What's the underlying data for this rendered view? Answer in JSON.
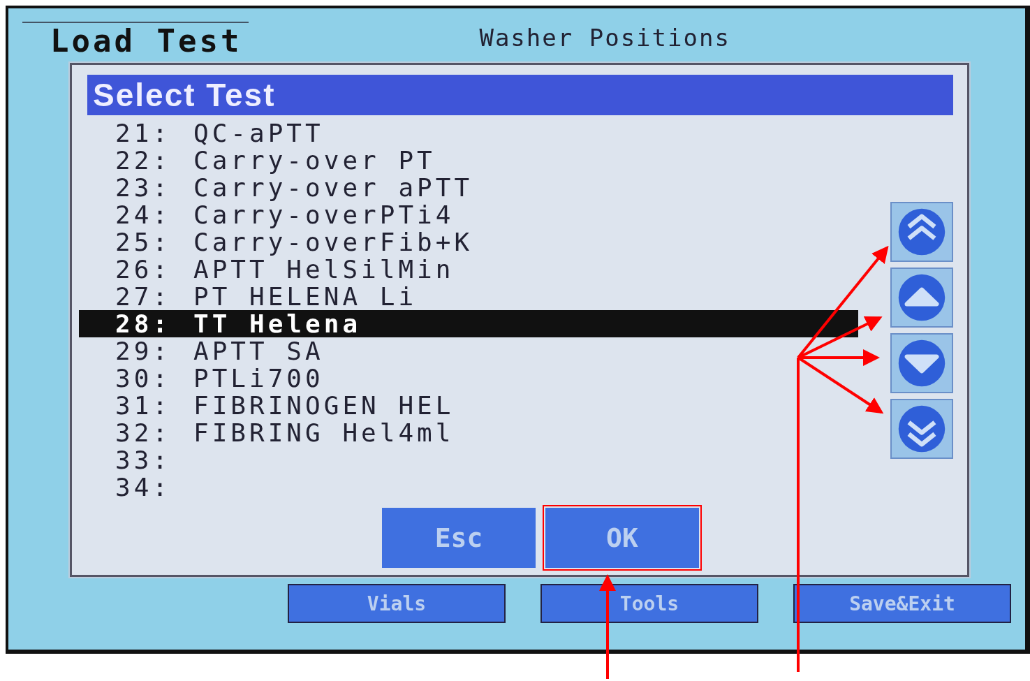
{
  "header": {
    "title": "Load Test",
    "section_label": "Washer Positions"
  },
  "dialog": {
    "title": "Select Test",
    "tests": [
      {
        "number": "21:",
        "name": "QC-aPTT",
        "selected": false
      },
      {
        "number": "22:",
        "name": "Carry-over PT",
        "selected": false
      },
      {
        "number": "23:",
        "name": "Carry-over aPTT",
        "selected": false
      },
      {
        "number": "24:",
        "name": "Carry-overPTi4",
        "selected": false
      },
      {
        "number": "25:",
        "name": "Carry-overFib+K",
        "selected": false
      },
      {
        "number": "26:",
        "name": "APTT HelSilMin",
        "selected": false
      },
      {
        "number": "27:",
        "name": "PT HELENA Li",
        "selected": false
      },
      {
        "number": "28:",
        "name": "TT Helena",
        "selected": true
      },
      {
        "number": "29:",
        "name": "APTT SA",
        "selected": false
      },
      {
        "number": "30:",
        "name": "PTLi700",
        "selected": false
      },
      {
        "number": "31:",
        "name": "FIBRINOGEN HEL",
        "selected": false
      },
      {
        "number": "32:",
        "name": "FIBRING Hel4ml",
        "selected": false
      },
      {
        "number": "33:",
        "selected": false
      },
      {
        "number": "34:",
        "selected": false
      }
    ],
    "scroll_buttons": [
      {
        "kind": "page-up"
      },
      {
        "kind": "up"
      },
      {
        "kind": "down"
      },
      {
        "kind": "page-down"
      }
    ],
    "buttons": [
      {
        "label": "Esc",
        "highlighted": false
      },
      {
        "label": "OK",
        "highlighted": true
      }
    ]
  },
  "bottom_buttons": [
    "Vials",
    "Tools",
    "Save&Exit"
  ]
}
